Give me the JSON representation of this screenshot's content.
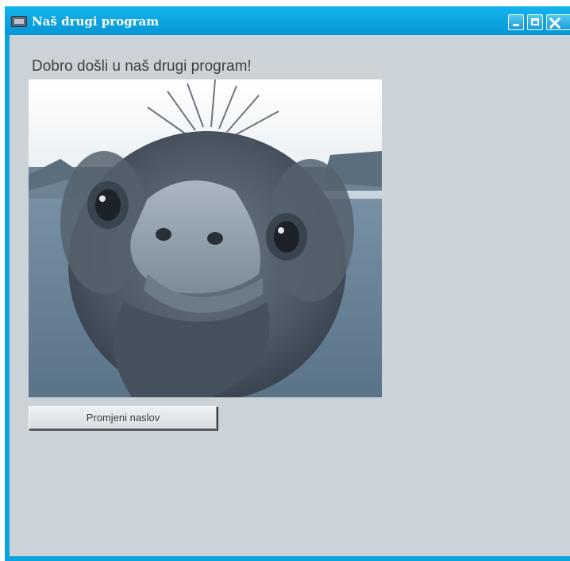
{
  "window": {
    "title": "Naš drugi program",
    "controls": {
      "minimize_icon": "minimize-icon",
      "maximize_icon": "maximize-icon",
      "close_icon": "close-icon"
    },
    "accent_color": "#0aa3e0"
  },
  "main": {
    "greeting": "Dobro došli u naš drugi program!",
    "image": {
      "subject": "ostrich head close-up",
      "icon": "ostrich-photo"
    },
    "button_label": "Promjeni naslov"
  }
}
